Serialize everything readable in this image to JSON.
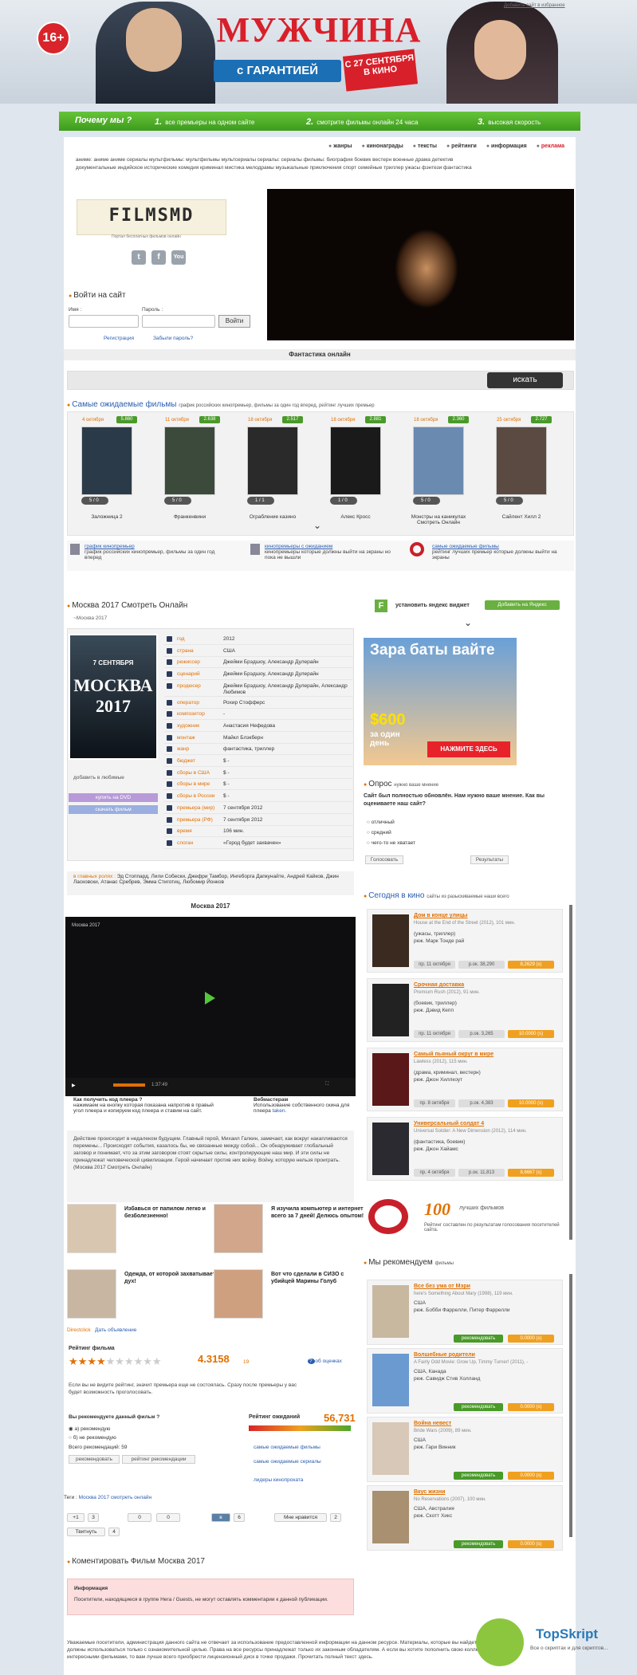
{
  "banner": {
    "age": "16+",
    "title": "МУЖЧИНА",
    "subtitle": "с ГАРАНТИЕЙ",
    "date": "С 27 СЕНТЯБРЯ В КИНО",
    "fav_link": "Добавить сайт в избранное"
  },
  "greenbar": {
    "why": "Почему мы ?",
    "steps": [
      {
        "n": "1.",
        "t": "все премьеры на одном сайте"
      },
      {
        "n": "2.",
        "t": "смотрите фильмы онлайн 24 часа"
      },
      {
        "n": "3.",
        "t": "высокая скорость"
      }
    ]
  },
  "topmenu": [
    "жанры",
    "кинонаграды",
    "тексты",
    "рейтинги",
    "информация",
    "реклама"
  ],
  "genres": {
    "row1": "аниме: аниме  аниме сериалы  мультфильмы: мультфильмы  мультсериалы  сериалы: сериалы  фильмы: биография  боевик  вестерн  военные  драма  детектив",
    "row2": "документальные  индийское  исторические  комедия  криминал  мистика  мелодрамы  музыкальные  приключения  спорт  семейные  триллер  ужасы  фэнтези  фантастика"
  },
  "logo": {
    "text": "FILMSMD",
    "sub": "Портал бесплатных фильмов онлайн"
  },
  "social": [
    "t",
    "f",
    "You"
  ],
  "login": {
    "title": "Войти на сайт",
    "name_label": "Имя :",
    "pass_label": "Пароль :",
    "button": "Войти",
    "register": "Регистрация",
    "forgot": "Забыли пароль?"
  },
  "section_label": "Фантастика онлайн",
  "search": {
    "button": "искать"
  },
  "awaited": {
    "title": "Самые ожидаемые фильмы",
    "sub": "график российских кинопремьер, фильмы за один год вперед, рейтинг лучших премьер",
    "items": [
      {
        "date": "4 октября",
        "score": "5.860",
        "name": "Заложница 2",
        "stars": "5 / 0"
      },
      {
        "date": "11 октября",
        "score": "2.638",
        "name": "Франкенвини",
        "stars": "5 / 0"
      },
      {
        "date": "18 октября",
        "score": "2.517",
        "name": "Ограбление казино",
        "stars": "1 / 1"
      },
      {
        "date": "18 октября",
        "score": "2.881",
        "name": "Алекс Кросс",
        "stars": "1 / 0"
      },
      {
        "date": "18 октября",
        "score": "2.360",
        "name": "Монстры на каникулах Смотреть Онлайн",
        "stars": "5 / 0"
      },
      {
        "date": "25 октября",
        "score": "2.727",
        "name": "Сайлент Хилл 2",
        "stars": "5 / 0"
      }
    ],
    "links": [
      {
        "t": "график кинопремьер",
        "d": "график российских кинопремьер, фильмы за один год вперед"
      },
      {
        "t": "кинопремьеры с ожиданием",
        "d": "кинопремьеры которые должны выйти на экраны но пока не вышли"
      },
      {
        "t": "самые ожидаемые фильмы",
        "d": "рейтинг лучших премьер которые должны выйти на экраны"
      }
    ]
  },
  "film": {
    "title": "Москва 2017 Смотреть Онлайн",
    "sub": "~Москва 2017",
    "poster_date": "7 СЕНТЯБРЯ",
    "poster_title": "МОСКВА 2017",
    "fav": "добавить в любимые",
    "buy": "купить на DVD",
    "download": "скачать фильм",
    "info": [
      {
        "k": "год",
        "v": "2012"
      },
      {
        "k": "страна",
        "v": "США"
      },
      {
        "k": "режиссер",
        "v": "Джейми Брэдшоу, Александр Дулерайн"
      },
      {
        "k": "сценарий",
        "v": "Джейми Брэдшоу, Александр Дулерайн"
      },
      {
        "k": "продюсер",
        "v": "Джейми Брэдшоу, Александр Дулерайн, Александр Любимов"
      },
      {
        "k": "оператор",
        "v": "Рохир Стофферс"
      },
      {
        "k": "композитор",
        "v": "-"
      },
      {
        "k": "художник",
        "v": "Анастасия Нефедова"
      },
      {
        "k": "монтаж",
        "v": "Майкл Блэкберн"
      },
      {
        "k": "жанр",
        "v": "фантастика, триллер"
      },
      {
        "k": "бюджет",
        "v": "$ -"
      },
      {
        "k": "сборы в США",
        "v": "$ -"
      },
      {
        "k": "сборы в мире",
        "v": "$ -"
      },
      {
        "k": "сборы в России",
        "v": "$ -"
      },
      {
        "k": "премьера (мир)",
        "v": "7 сентября 2012"
      },
      {
        "k": "премьера (РФ)",
        "v": "7 сентября 2012"
      },
      {
        "k": "время",
        "v": "106 мин."
      },
      {
        "k": "слоган",
        "v": "«Город будет захвачен»"
      }
    ],
    "roles_label": "в главных ролях :",
    "roles": "Эд Стоппард, Лили Собески, Джефри Тамбор, Ингеборга Дапкунайте, Андрей Кайков, Джин Ласковски, Атанас Сребрев, Эмма Стиготиц, Любомир Йонков"
  },
  "video": {
    "label": "Москва 2017",
    "caption": "Москва 2017",
    "time": "1:37:49",
    "howto_title": "Как получить код плеера ?",
    "howto": "нажимаем на кнопку которая показана напротив в правый угол плеера и копируем код плеера и ставим на сайт.",
    "webm_title": "Вебмастерам",
    "webm": "Использование собственного скина для плеера",
    "webm_link": "taken.",
    "desc": "Действие происходит в недалеком будущем. Главный герой, Михаил Галкин, замечает, как вокруг накапливаются перемены... Происходят события, казалось бы, не связанные между собой... Он обнаруживает глобальный заговор и понимает, что за этим заговором стоят скрытые силы, контролирующие наш мир. И эти силы не принадлежат человеческой цивилизации. Герой начинает против них войну. Войну, которую нельзя проиграть. (Москва 2017 Смотреть Онлайн)"
  },
  "ads": [
    {
      "t": "Избавься от папилом легко и безболезненно!"
    },
    {
      "t": "Я изучила компьютер и интернет всего за 7 дней! Делюсь опытом!"
    },
    {
      "t": "Одежда, от которой захватывает дух!"
    },
    {
      "t": "Вот что сделали в СИЗО с убийцей Марины Голуб"
    }
  ],
  "ad_links": {
    "a": "Directclick",
    "b": "Дать объявление"
  },
  "rating": {
    "title": "Рейтинг фильма",
    "value": "4.3158",
    "count": "19",
    "about": "об оценках",
    "note": "Если вы не видите рейтинг, значит премьера еще не состоялась. Сразу после премьеры у вас будет возможность проголосовать.",
    "stars_filled": 4
  },
  "recommend": {
    "q": "Вы рекомендуете данный фильм ?",
    "yes": "а) рекомендую",
    "no": "б) не рекомендую",
    "total": "Всего рекомендаций: 59",
    "btn1": "рекомендовать",
    "btn2": "рейтинг рекомендации"
  },
  "await": {
    "title": "Рейтинг ожиданий",
    "num": "56,731",
    "links": [
      "самые ожидаемые фильмы",
      "самые ожидаемые сериалы",
      "лидеры кинопроката"
    ]
  },
  "tags": {
    "label": "Теги :",
    "value": "Москва 2017 смотреть онлайн"
  },
  "share": {
    "g": "+1",
    "g_count": "3",
    "c1": "0",
    "c2": "0",
    "vk": "6",
    "fb": "Мне нравится",
    "fb_count": "2",
    "tw": "Твитнуть",
    "tw_count": "4"
  },
  "comments": {
    "title": "Коментировать Фильм Москва 2017",
    "info_title": "Информация",
    "info": "Посетители, находящиеся в группе Hera / Guests, не могут оставлять комментарии к данной публикации."
  },
  "footer": "Уважаемые посетители, администрация данного сайта не отвечает за использование предоставленной информации на данном ресурсе. Материалы, которые вы найдете на сайте, должны использоваться только с ознакомительной целью. Права на все ресурсы принадлежат только их законным обладателям. А если вы хотите пополнить свою коллекцию новыми, интересными фильмами, то вам лучше всего приобрести лицензионный диск в точке продажи. Прочитать полный текст здесь.",
  "watermark": {
    "name": "TopSkript",
    "tag": "Все о скриптах и для скриптов..."
  },
  "right": {
    "yandex": "установить яндекс виджет",
    "yandex_btn": "Добавить на Яндекс",
    "ad": {
      "title": "Зара баты вайте",
      "price": "$600",
      "sub": "за один день",
      "btn": "НАЖМИТЕ ЗДЕСЬ"
    },
    "poll": {
      "title": "Опрос",
      "sub": "нужно ваше мнение",
      "q": "Сайт был полностью обновлён. Нам нужно ваше мнение. Как вы оцениваете наш сайт?",
      "opts": [
        "отличный",
        "средний",
        "чего-то не хватает"
      ],
      "vote": "Голосовать",
      "results": "Результаты"
    },
    "today": {
      "title": "Сегодня в кино",
      "sub": "сайты из разыскиваемые наши всего",
      "items": [
        {
          "t": "Дом в конце улицы",
          "o": "House at the End of the Street (2012), 101 мин.",
          "g": "(ужасы, триллер)",
          "d": "реж. Марк Тонде рай",
          "b1": "пр. 11 октября",
          "b2": "р.ок. 38,290",
          "b3": "8,2629 (s)"
        },
        {
          "t": "Срочная доставка",
          "o": "Premium Rush (2012), 91 мин.",
          "g": "(боевик, триллер)",
          "d": "реж. Дэвид Кепп",
          "b1": "пр. 11 октября",
          "b2": "р.ок. 3,265",
          "b3": "10.0000 (s)"
        },
        {
          "t": "Самый пьяный округ в мире",
          "o": "Lawless (2012), 115 мин.",
          "g": "(драма, криминал, вестерн)",
          "d": "реж. Джон Хиллкоут",
          "b1": "пр. 8 октября",
          "b2": "р.ок. 4,383",
          "b3": "10.0000 (s)"
        },
        {
          "t": "Универсальный солдат 4",
          "o": "Universal Soldier: A New Dimension (2012), 114 мин.",
          "g": "(фантастика, боевик)",
          "d": "реж. Джон Хайамс",
          "b1": "пр. 4 октября",
          "b2": "р.ок. 11,813",
          "b3": "8,6667 (s)"
        }
      ]
    },
    "top100": {
      "n": "100",
      "l": "лучших фильмов",
      "d": "Рейтинг составлен по результатам голосования посетителей сайта."
    },
    "recs": {
      "title": "Мы рекомендуем",
      "sub": "фильмы",
      "items": [
        {
          "t": "Все без ума от Мэри",
          "o": "here's Something About Mary (1998), 119 мин.",
          "c": "США",
          "d": "реж. Бобби Фаррелли, Питер Фаррелли",
          "btn": "рекомендовать",
          "s": "0.0000 (s)"
        },
        {
          "t": "Волшебные родители",
          "o": "A Fairly Odd Movie: Grow Up, Timmy Turner! (2011), -",
          "c": "США, Канада",
          "d": "реж. Савидж Стив Холланд",
          "btn": "рекомендовать",
          "s": "0.0000 (s)"
        },
        {
          "t": "Война невест",
          "o": "Bride Wars (2009), 89 мин.",
          "c": "США",
          "d": "реж. Гари Винник",
          "btn": "рекомендовать",
          "s": "0.0000 (s)"
        },
        {
          "t": "Вкус жизни",
          "o": "No Reservations (2007), 100 мин.",
          "c": "США, Австралия",
          "d": "реж. Скотт Хикс",
          "btn": "рекомендовать",
          "s": "0.0000 (s)"
        }
      ]
    }
  }
}
